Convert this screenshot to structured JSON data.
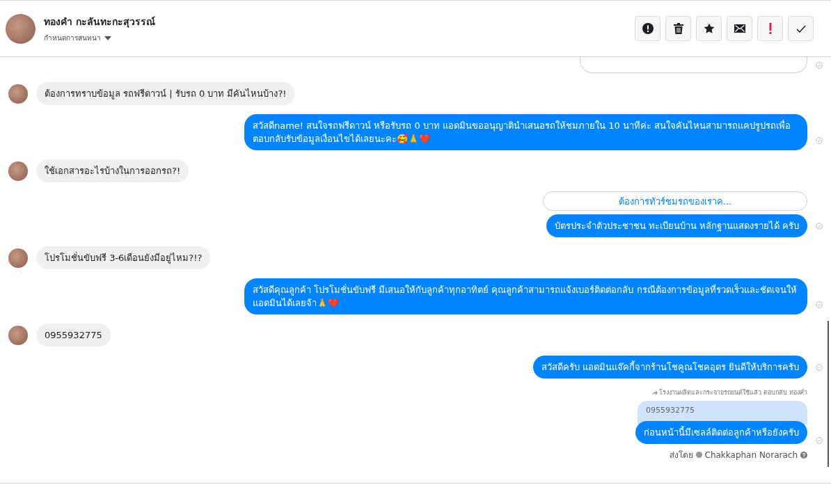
{
  "header": {
    "name": "ทองคำ กะลันทะกะสุวรรณ์",
    "subtitle": "กำหนดการสนทนา"
  },
  "messages": [
    {
      "kind": "cut_outgoing"
    },
    {
      "kind": "incoming",
      "text": "ต้องการทราบข้อมูล รถฟรีดาวน์ | รับรถ 0 บาท มีคันไหนบ้าง?!"
    },
    {
      "kind": "outgoing",
      "text": "สวัสดีname! สนใจรถฟรีดาวน์ หรือรับรถ 0 บาท แอดมินขออนุญาตินำเสนอรถให้ชมภายใน 10 นาทีค่ะ สนใจคันไหนสามารถแคปรูปรถเพื่อตอบกลับรับข้อมูลเงื่อนไขได้เลยนะคะ🥰🙏❤️"
    },
    {
      "kind": "incoming",
      "text": "ใช้เอกสารอะไรบ้างในการออกรถ?!"
    },
    {
      "kind": "quick_reply",
      "text": "ต้องการทัวร์ชมรถของเราค..."
    },
    {
      "kind": "outgoing",
      "text": "บัตรประจำตัวประชาชน ทะเบียนบ้าน หลักฐานแสดงรายได้ ครับ"
    },
    {
      "kind": "incoming",
      "text": "โปรโมชั่นขับฟรี 3-6เดือนยังมีอยู่ไหม?!?"
    },
    {
      "kind": "outgoing",
      "text": "สวัสดีคุณลูกค้า โปรโมชั่นขับฟรี มีเสนอให้กับลูกค้าทุกอาทิตย์ คุณลูกค้าสามารถแจ้งเบอร์ติดต่อกลับ กรณีต้องการข้อมูลที่รวดเร็วและชัดเจนให้แอดมินได้เลยจ้า🙏❤️"
    },
    {
      "kind": "incoming",
      "text": "0955932775"
    },
    {
      "kind": "outgoing",
      "text": "สวัสดีครับ แอดมินแจ๊คกี้จากร้านโชคูณโชคอุดร ยินดีให้บริการครับ"
    },
    {
      "kind": "reply",
      "context": "โรงงานผลิตและกระจายรถยนต์ใช้แล้ว ตอบกลับ ทองคำ",
      "quoted": "0955932775",
      "text": "ก่อนหน้านี้มีเซลล์ติดต่อลูกค้าหรือยังครับ"
    }
  ],
  "sent_by": {
    "label": "ส่งโดย",
    "name": "Chakkaphan Norarach"
  }
}
